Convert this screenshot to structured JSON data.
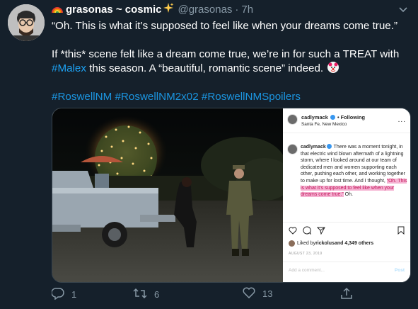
{
  "tweet": {
    "display_name": "grasonas ~ cosmic",
    "handle": "@grasonas",
    "separator": "·",
    "time": "7h",
    "paragraph1": "“Oh. This is what it’s supposed to feel like when your dreams come true.”",
    "paragraph2_part1": "If *this* scene felt like a dream come true, we’re in for such a TREAT with ",
    "paragraph2_mention": "#Malex",
    "paragraph2_part2": " this season. A “beautiful, romantic scene” indeed. ",
    "hashtags": [
      "#RoswellNM",
      "#RoswellNM2x02",
      "#RoswellNMSpoilers"
    ]
  },
  "instagram": {
    "username": "cadlymack",
    "follow_sep": "•",
    "follow_label": "Following",
    "location": "Santa Fe, New Mexico",
    "more": "...",
    "caption_user": "cadlymack",
    "caption_text": " There was a moment tonight, in that electric wind blown aftermath of a lightning storm, where I looked around at our team of dedicated men and women supporting each other, pushing each other, and working together to make up for lost time. And I thought, ",
    "caption_highlight": "“Oh. This is what it’s supposed to feel like when your dreams come true.”",
    "caption_end": " Oh.",
    "liked_prefix": "Liked by ",
    "liked_user": "rickolus",
    "liked_suffix": " and 4,349 others",
    "date": "AUGUST 23, 2019",
    "comment_placeholder": "Add a comment...",
    "post_label": "Post"
  },
  "actions": {
    "reply_count": "1",
    "retweet_count": "6",
    "like_count": "13"
  },
  "colors": {
    "background": "#15202b",
    "secondary_text": "#8899a6",
    "link": "#1da1f2",
    "highlight": "#f5b2d2"
  },
  "icons": [
    "rainbow-icon",
    "sparkles-icon",
    "chevron-down-icon",
    "clown-face-icon",
    "reply-icon",
    "retweet-icon",
    "heart-icon",
    "share-icon",
    "verified-icon",
    "instagram-heart-icon",
    "instagram-comment-icon",
    "instagram-share-icon",
    "bookmark-icon"
  ]
}
